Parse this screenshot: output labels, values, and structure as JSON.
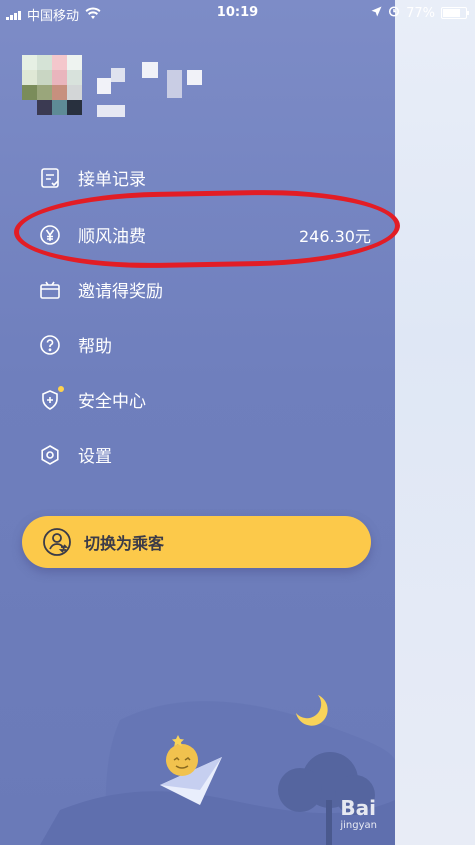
{
  "status_bar": {
    "carrier": "中国移动",
    "time": "10:19",
    "battery_percent": "77%",
    "battery_level": 0.77,
    "icons": [
      "signal-icon",
      "wifi-icon",
      "location-icon",
      "alarm-icon",
      "battery-icon"
    ]
  },
  "profile": {
    "avatar_state": "pixelated",
    "name_state": "pixelated"
  },
  "menu": {
    "items": [
      {
        "id": "order-records",
        "label": "接单记录",
        "icon": "receipt-icon"
      },
      {
        "id": "fuel-fee",
        "label": "顺风油费",
        "value": "246.30元",
        "icon": "yuan-icon"
      },
      {
        "id": "invite-rewards",
        "label": "邀请得奖励",
        "icon": "gift-icon"
      },
      {
        "id": "help",
        "label": "帮助",
        "icon": "help-icon"
      },
      {
        "id": "safety-center",
        "label": "安全中心",
        "icon": "shield-plus-icon",
        "badge": true
      },
      {
        "id": "settings",
        "label": "设置",
        "icon": "gear-icon"
      }
    ]
  },
  "switch_button": {
    "label": "切换为乘客",
    "icon": "user-switch-icon"
  },
  "watermark": {
    "brand": "Bai",
    "sub": "jingyan"
  },
  "colors": {
    "drawer_bg": "#7483c0",
    "accent_yellow": "#fcc94a",
    "annotation_red": "#e21d25",
    "text": "#ffffff"
  }
}
